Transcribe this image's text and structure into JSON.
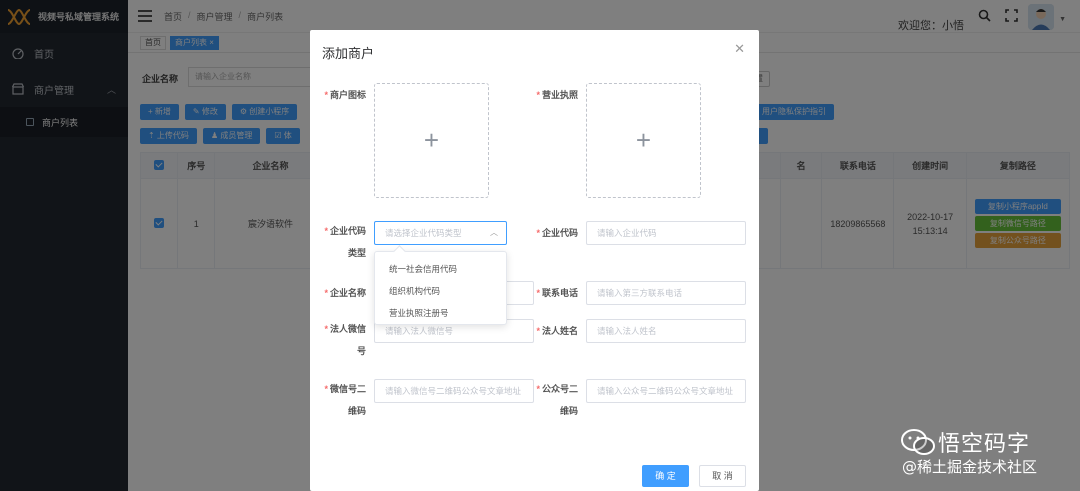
{
  "app": {
    "title": "视频号私域管理系统"
  },
  "sidebar": {
    "items": [
      {
        "label": "首页",
        "icon": "dashboard-icon"
      },
      {
        "label": "商户管理",
        "icon": "store-icon",
        "expanded": true
      }
    ],
    "subitems": [
      {
        "label": "商户列表",
        "active": true
      }
    ]
  },
  "topbar": {
    "breadcrumb": [
      "首页",
      "商户管理",
      "商户列表"
    ],
    "welcome": "欢迎您：小悟"
  },
  "tags": [
    {
      "label": "首页"
    },
    {
      "label": "商户列表 ×",
      "active": true
    }
  ],
  "filter": {
    "label": "企业名称",
    "placeholder": "请输入企业名称"
  },
  "toolbar": {
    "row1": [
      "+ 新增",
      "✎ 修改",
      "⚙ 创建小程序"
    ],
    "row2": [
      "⇡ 上传代码",
      "♟ 成员管理",
      "☑ 体"
    ],
    "right_row1": "用户隐私保护指引",
    "right_outline": "置"
  },
  "table": {
    "headers": [
      "",
      "序号",
      "企业名称",
      "",
      "名",
      "联系电话",
      "创建时间",
      "复制路径"
    ],
    "row": {
      "index": "1",
      "company": "宸汐语软件",
      "partial": "9",
      "phone": "18209865568",
      "created": "2022-10-17 15:13:14"
    },
    "copy_buttons": [
      {
        "label": "复制小程序appId",
        "color": "#409eff"
      },
      {
        "label": "复制微信号路径",
        "color": "#67c23a"
      },
      {
        "label": "复制公众号路径",
        "color": "#e6a23c"
      }
    ]
  },
  "dialog": {
    "title": "添加商户",
    "fields": {
      "merchant_icon": "商户图标",
      "business_license": "营业执照",
      "code_type": "企业代码类型",
      "code_type_placeholder": "请选择企业代码类型",
      "code": "企业代码",
      "code_placeholder": "请输入企业代码",
      "company_name": "企业名称",
      "phone": "联系电话",
      "phone_placeholder": "请输入第三方联系电话",
      "legal_wechat": "法人微信号",
      "legal_wechat_placeholder": "请输入法人微信号",
      "legal_name": "法人姓名",
      "legal_name_placeholder": "请输入法人姓名",
      "wechat_qr": "微信号二维码",
      "wechat_qr_placeholder": "请输入微信号二维码公众号文章地址",
      "mp_qr": "公众号二维码",
      "mp_qr_placeholder": "请输入公众号二维码公众号文章地址"
    },
    "dropdown_options": [
      "统一社会信用代码",
      "组织机构代码",
      "营业执照注册号"
    ],
    "ok_label": "确 定",
    "cancel_label": "取 消"
  },
  "watermark": {
    "title": "悟空码字",
    "subtitle": "@稀土掘金技术社区"
  }
}
